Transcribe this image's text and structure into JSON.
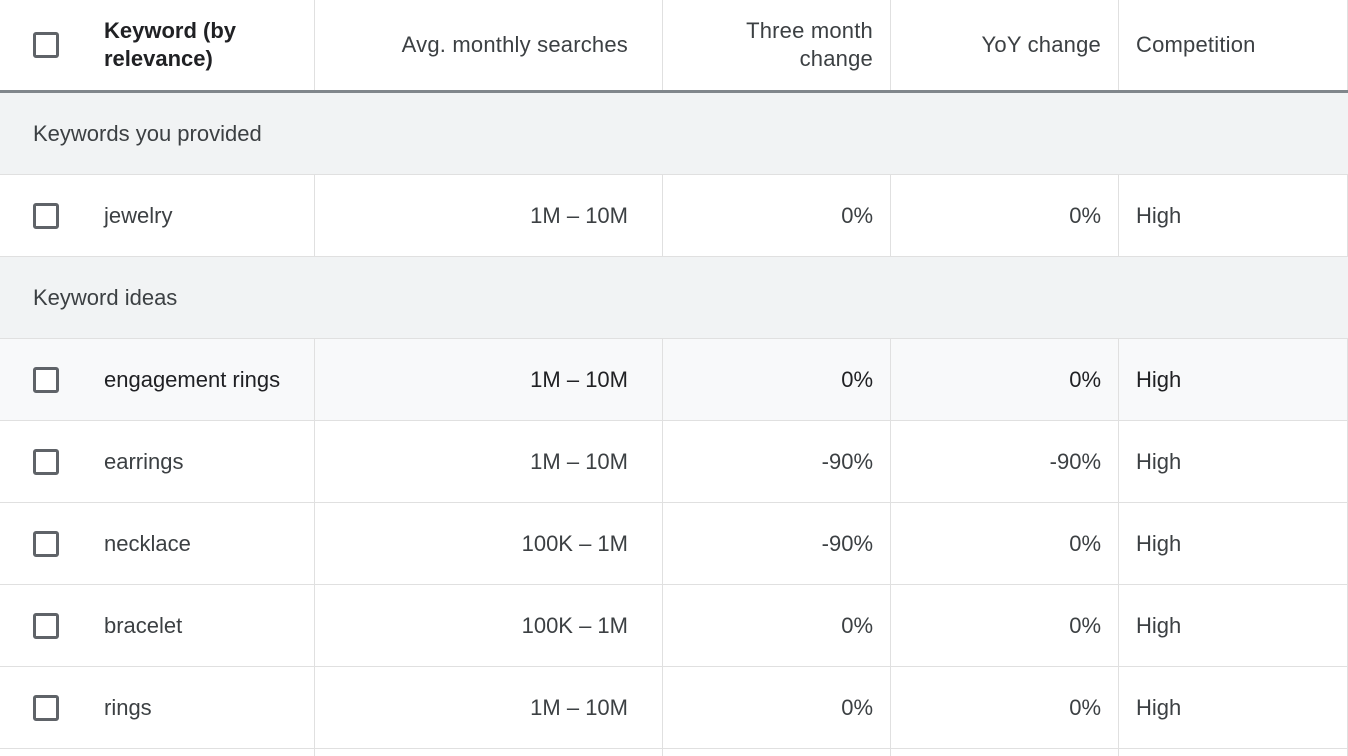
{
  "table": {
    "headers": {
      "keyword": "Keyword (by relevance)",
      "avg_monthly_searches": "Avg. monthly searches",
      "three_month_change": "Three month change",
      "yoy_change": "YoY change",
      "competition": "Competition"
    },
    "sections": {
      "provided": "Keywords you provided",
      "ideas": "Keyword ideas"
    },
    "provided_rows": [
      {
        "keyword": "jewelry",
        "avg": "1M – 10M",
        "three": "0%",
        "yoy": "0%",
        "competition": "High"
      }
    ],
    "idea_rows": [
      {
        "keyword": "engagement rings",
        "avg": "1M – 10M",
        "three": "0%",
        "yoy": "0%",
        "competition": "High"
      },
      {
        "keyword": "earrings",
        "avg": "1M – 10M",
        "three": "-90%",
        "yoy": "-90%",
        "competition": "High"
      },
      {
        "keyword": "necklace",
        "avg": "100K – 1M",
        "three": "-90%",
        "yoy": "0%",
        "competition": "High"
      },
      {
        "keyword": "bracelet",
        "avg": "100K – 1M",
        "three": "0%",
        "yoy": "0%",
        "competition": "High"
      },
      {
        "keyword": "rings",
        "avg": "1M – 10M",
        "three": "0%",
        "yoy": "0%",
        "competition": "High"
      }
    ]
  }
}
